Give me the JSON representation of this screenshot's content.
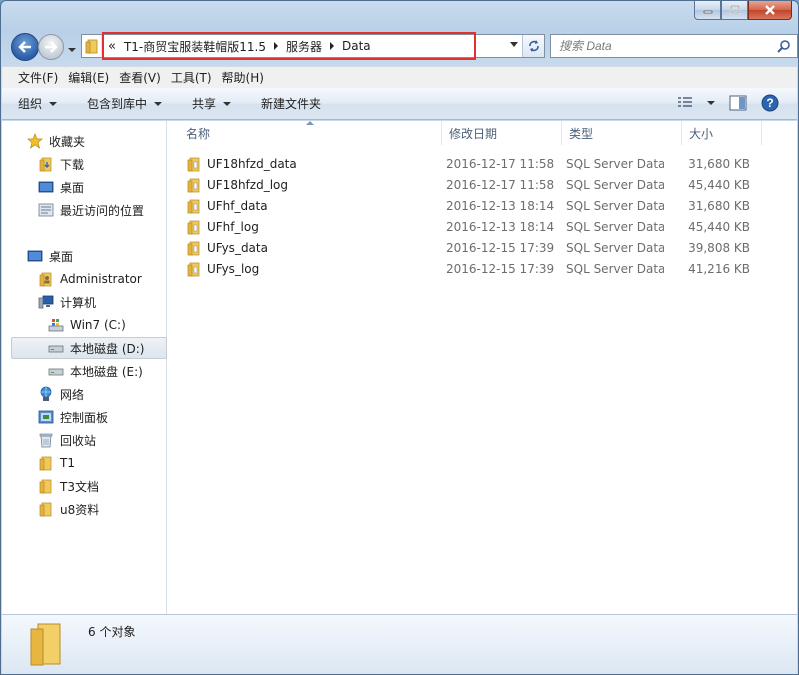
{
  "address": {
    "lead": "«",
    "segments": [
      "T1-商贸宝服装鞋帽版11.5",
      "服务器",
      "Data"
    ]
  },
  "search": {
    "placeholder": "搜索 Data"
  },
  "menu": [
    "文件(F)",
    "编辑(E)",
    "查看(V)",
    "工具(T)",
    "帮助(H)"
  ],
  "toolbar": {
    "organize": "组织",
    "include_library": "包含到库中",
    "share": "共享",
    "new_folder": "新建文件夹"
  },
  "nav": {
    "favorites": "收藏夹",
    "downloads": "下载",
    "desktop_fav": "桌面",
    "recent": "最近访问的位置",
    "desktop": "桌面",
    "administrator": "Administrator",
    "computer": "计算机",
    "drive_c": "Win7 (C:)",
    "drive_d": "本地磁盘 (D:)",
    "drive_e": "本地磁盘 (E:)",
    "network": "网络",
    "control_panel": "控制面板",
    "recycle_bin": "回收站",
    "t1": "T1",
    "t3": "T3文档",
    "u8": "u8资料"
  },
  "columns": {
    "name": "名称",
    "date": "修改日期",
    "type": "类型",
    "size": "大小"
  },
  "files": [
    {
      "name": "UF18hfzd_data",
      "date": "2016-12-17 11:58",
      "type": "SQL Server Data...",
      "size": "31,680 KB"
    },
    {
      "name": "UF18hfzd_log",
      "date": "2016-12-17 11:58",
      "type": "SQL Server Data...",
      "size": "45,440 KB"
    },
    {
      "name": "UFhf_data",
      "date": "2016-12-13 18:14",
      "type": "SQL Server Data...",
      "size": "31,680 KB"
    },
    {
      "name": "UFhf_log",
      "date": "2016-12-13 18:14",
      "type": "SQL Server Data...",
      "size": "45,440 KB"
    },
    {
      "name": "UFys_data",
      "date": "2016-12-15 17:39",
      "type": "SQL Server Data...",
      "size": "39,808 KB"
    },
    {
      "name": "UFys_log",
      "date": "2016-12-15 17:39",
      "type": "SQL Server Data...",
      "size": "41,216 KB"
    }
  ],
  "status": {
    "count": "6 个对象"
  }
}
